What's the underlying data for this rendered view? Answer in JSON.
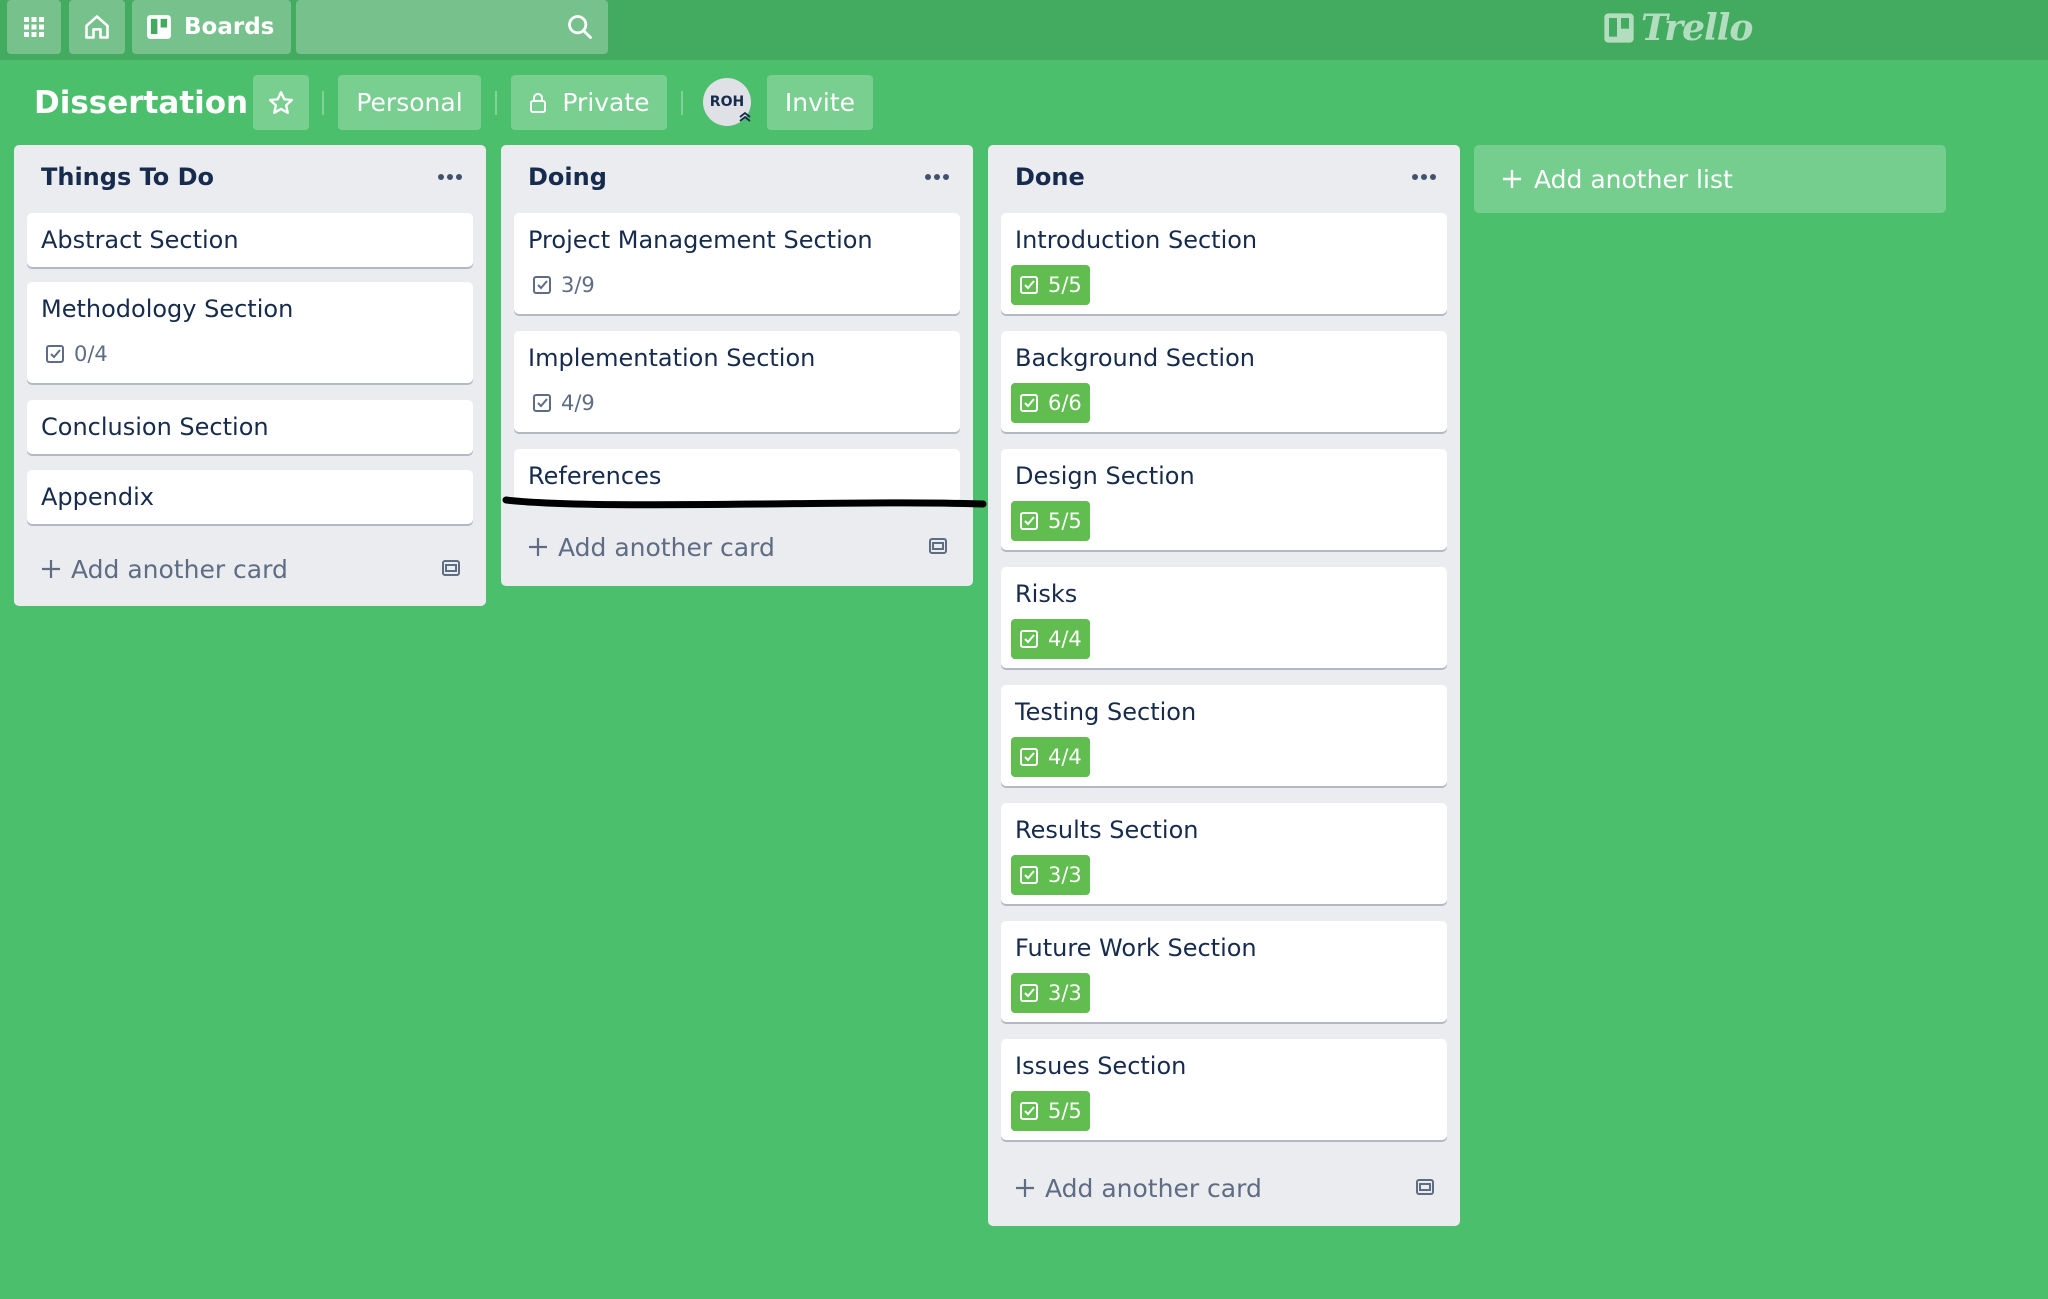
{
  "topbar": {
    "apps_icon": "grid-icon",
    "home_icon": "home-icon",
    "boards_label": "Boards",
    "search_placeholder": "",
    "logo_text": "Trello"
  },
  "board": {
    "title": "Dissertation",
    "visibility_team": "Personal",
    "visibility_private": "Private",
    "member_initials": "ROH",
    "invite_label": "Invite"
  },
  "lists": [
    {
      "title": "Things To Do",
      "cards": [
        {
          "title": "Abstract Section"
        },
        {
          "title": "Methodology Section",
          "checklist": "0/4"
        },
        {
          "title": "Conclusion Section"
        },
        {
          "title": "Appendix"
        }
      ],
      "add_card_label": "Add another card"
    },
    {
      "title": "Doing",
      "cards": [
        {
          "title": "Project Management Section",
          "checklist": "3/9"
        },
        {
          "title": "Implementation Section",
          "checklist": "4/9"
        },
        {
          "title": "References"
        }
      ],
      "add_card_label": "Add another card"
    },
    {
      "title": "Done",
      "cards": [
        {
          "title": "Introduction Section",
          "checklist": "5/5"
        },
        {
          "title": "Background Section",
          "checklist": "6/6"
        },
        {
          "title": "Design Section",
          "checklist": "5/5"
        },
        {
          "title": "Risks",
          "checklist": "4/4"
        },
        {
          "title": "Testing Section",
          "checklist": "4/4"
        },
        {
          "title": "Results Section",
          "checklist": "3/3"
        },
        {
          "title": "Future Work Section",
          "checklist": "3/3"
        },
        {
          "title": "Issues Section",
          "checklist": "5/5"
        }
      ],
      "add_card_label": "Add another card"
    }
  ],
  "add_list_label": "Add another list",
  "colors": {
    "background": "#4bbf6b",
    "list_bg": "#ebecf0",
    "complete_badge": "#61bd4f"
  }
}
